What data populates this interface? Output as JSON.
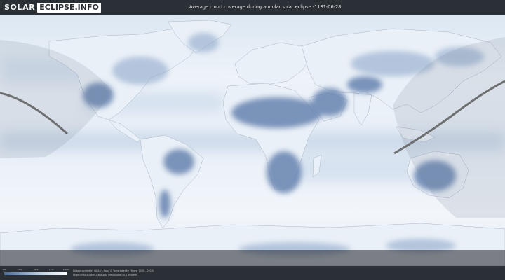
{
  "header": {
    "logo_left": "SOLAR",
    "logo_right": "ECLIPSE.INFO",
    "title": "Average cloud coverage during annular solar eclipse -1181-06-28"
  },
  "legend": {
    "ticks": [
      "0%",
      "25%",
      "50%",
      "75%",
      "100%"
    ],
    "colors": [
      "#4a6a98",
      "#7896c0",
      "#aec4de",
      "#d8e4f0",
      "#ffffff"
    ]
  },
  "credits": {
    "line1": "Data provided by NASA's Aqua & Terra satellite (Years: 2000 - 2019)",
    "line2": "https://neo.sci.gsfc.nasa.gov | Resolution: 0.1 degrees"
  },
  "map": {
    "projection": "equirectangular",
    "ocean_color": "#e4edf6",
    "cloudy_color": "#ffffff",
    "clear_color": "#5d7baa",
    "eclipse_path_color": "#5c5c5c",
    "night_shade_color": "#1f2228"
  }
}
